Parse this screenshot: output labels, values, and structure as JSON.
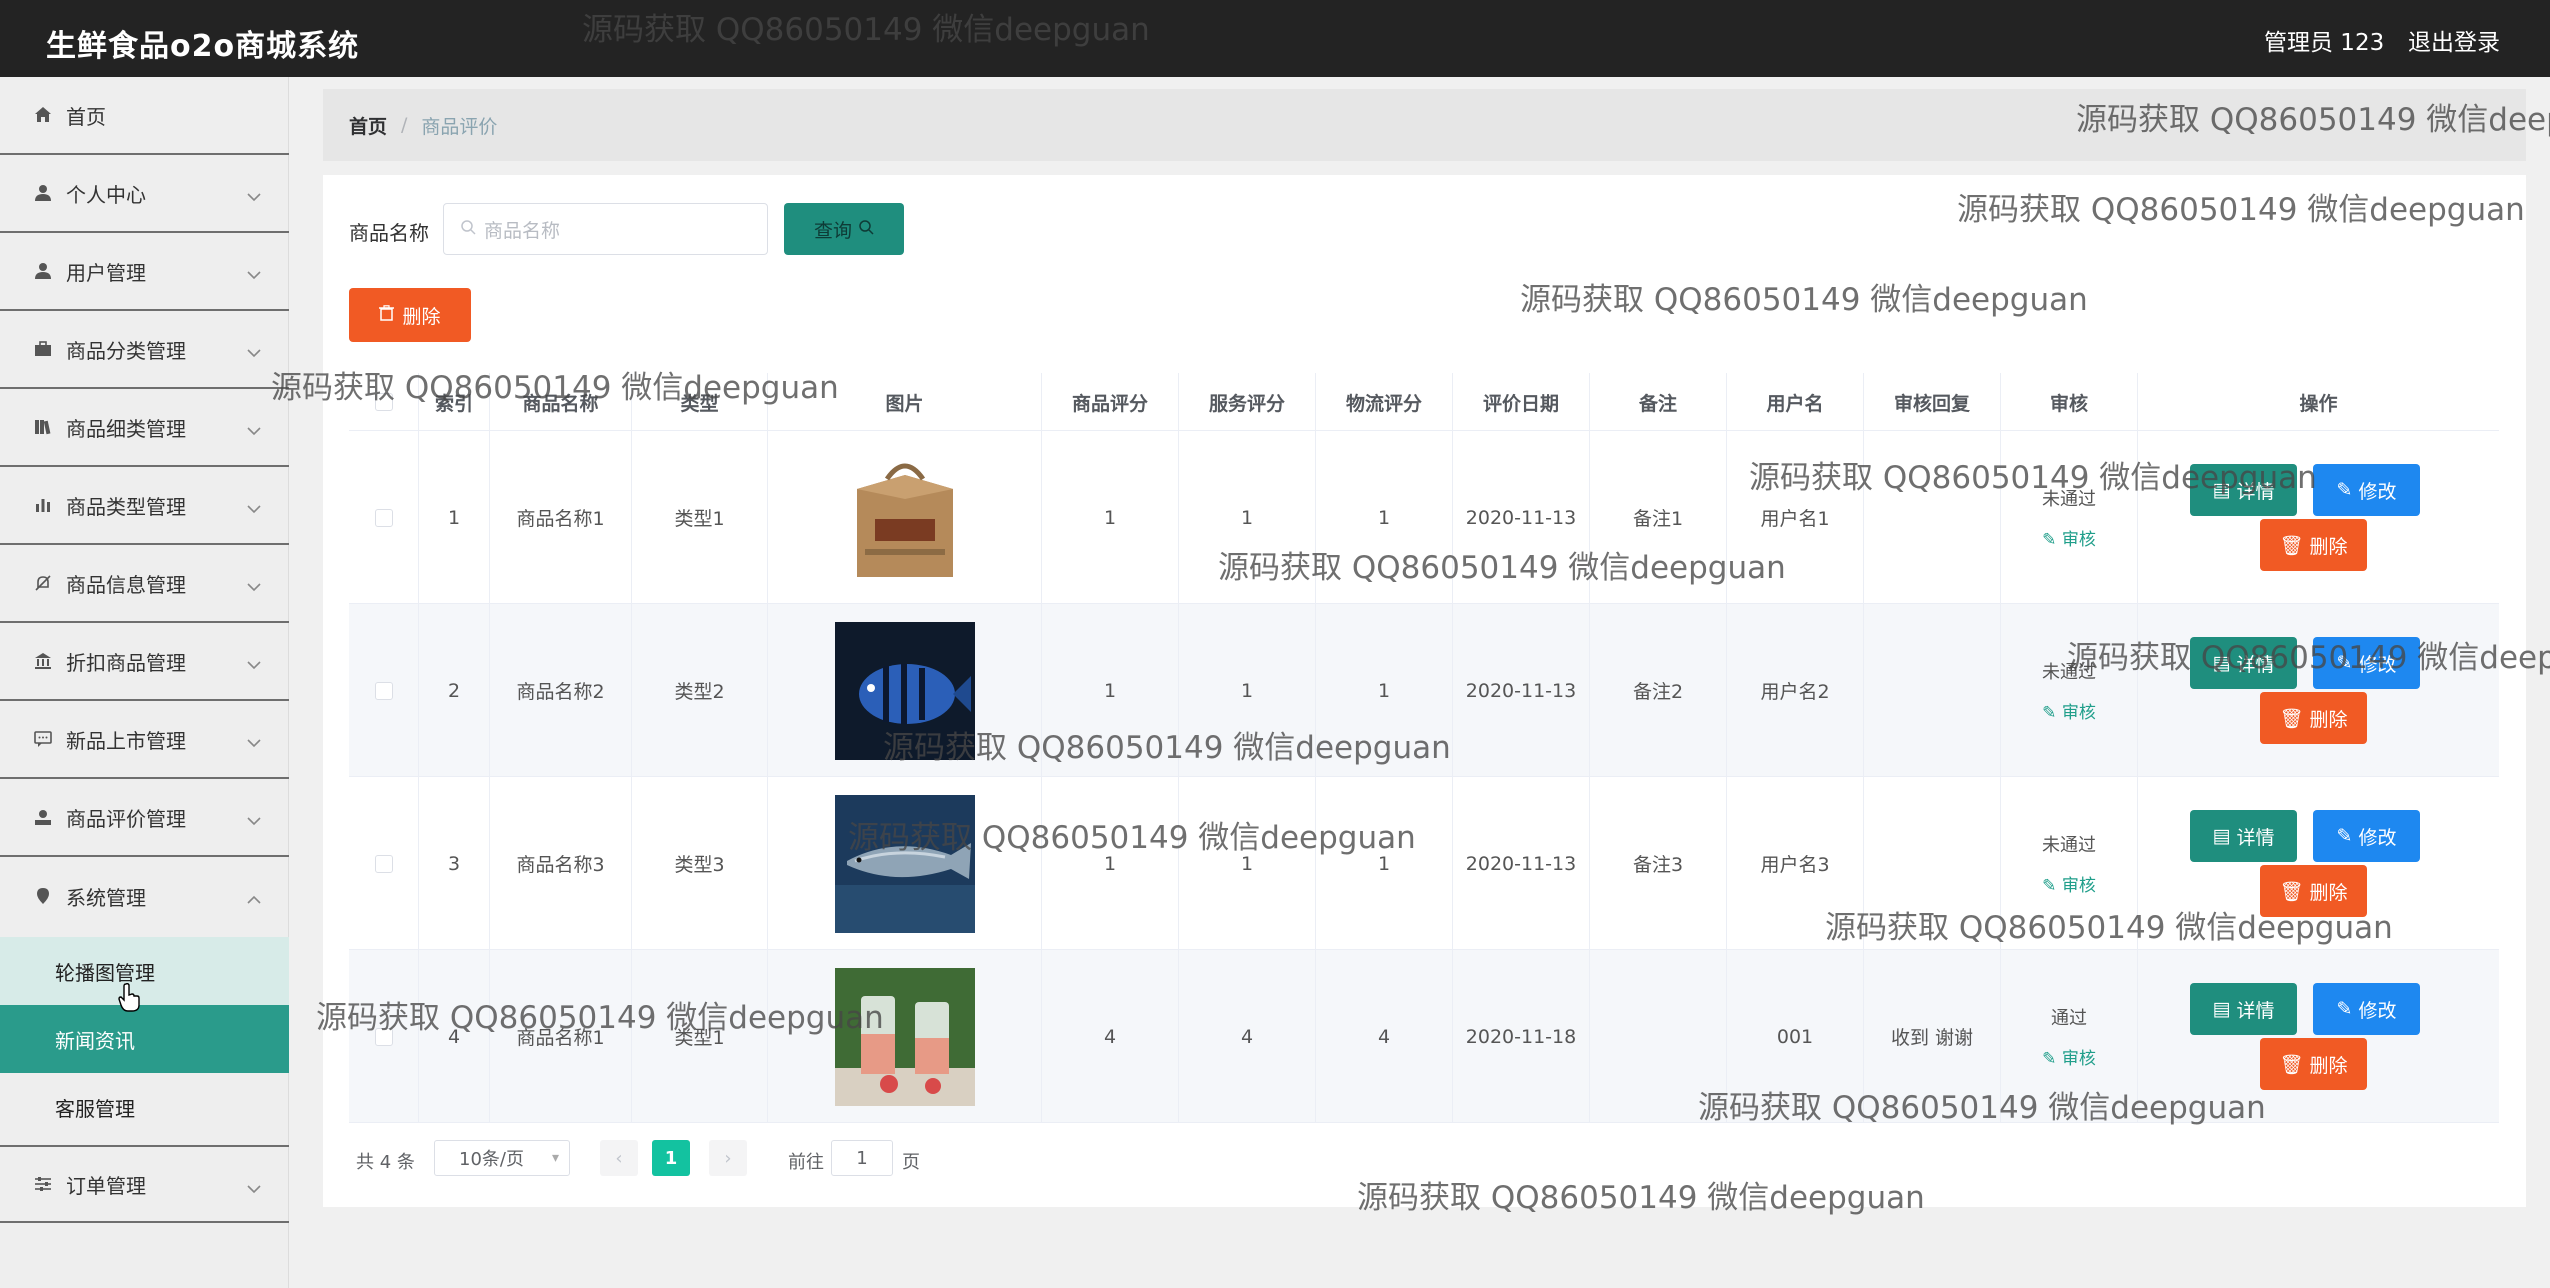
{
  "topbar": {
    "title": "生鲜食品o2o商城系统",
    "admin": "管理员 123",
    "logout": "退出登录"
  },
  "sidebar": {
    "items": [
      {
        "label": "首页",
        "icon": "home-icon"
      },
      {
        "label": "个人中心",
        "icon": "user-icon"
      },
      {
        "label": "用户管理",
        "icon": "user-icon"
      },
      {
        "label": "商品分类管理",
        "icon": "suitcase-icon"
      },
      {
        "label": "商品细类管理",
        "icon": "books-icon"
      },
      {
        "label": "商品类型管理",
        "icon": "bar-chart-icon"
      },
      {
        "label": "商品信息管理",
        "icon": "bell-off-icon"
      },
      {
        "label": "折扣商品管理",
        "icon": "bank-icon"
      },
      {
        "label": "新品上市管理",
        "icon": "chat-icon"
      },
      {
        "label": "商品评价管理",
        "icon": "user-card-icon"
      },
      {
        "label": "系统管理",
        "icon": "pin-icon"
      }
    ],
    "sub_items": [
      {
        "label": "轮播图管理"
      },
      {
        "label": "新闻资讯"
      },
      {
        "label": "客服管理"
      }
    ],
    "last_item": {
      "label": "订单管理",
      "icon": "sliders-icon"
    }
  },
  "breadcrumb": {
    "home": "首页",
    "separator": "/",
    "current": "商品评价"
  },
  "search": {
    "label": "商品名称",
    "placeholder": "商品名称",
    "button": "查询"
  },
  "batch_delete": "删除",
  "table": {
    "headers": [
      "索引",
      "商品名称",
      "类型",
      "图片",
      "商品评分",
      "服务评分",
      "物流评分",
      "评价日期",
      "备注",
      "用户名",
      "审核回复",
      "审核",
      "操作"
    ],
    "rows": [
      {
        "index": "1",
        "name": "商品名称1",
        "type": "类型1",
        "image": "gift-box",
        "goods_score": "1",
        "service_score": "1",
        "logistics_score": "1",
        "date": "2020-11-13",
        "remark": "备注1",
        "user": "用户名1",
        "reply": "",
        "status": "未通过",
        "review": "审核"
      },
      {
        "index": "2",
        "name": "商品名称2",
        "type": "类型2",
        "image": "striped-fish",
        "goods_score": "1",
        "service_score": "1",
        "logistics_score": "1",
        "date": "2020-11-13",
        "remark": "备注2",
        "user": "用户名2",
        "reply": "",
        "status": "未通过",
        "review": "审核"
      },
      {
        "index": "3",
        "name": "商品名称3",
        "type": "类型3",
        "image": "fish",
        "goods_score": "1",
        "service_score": "1",
        "logistics_score": "1",
        "date": "2020-11-13",
        "remark": "备注3",
        "user": "用户名3",
        "reply": "",
        "status": "未通过",
        "review": "审核"
      },
      {
        "index": "4",
        "name": "商品名称1",
        "type": "类型1",
        "image": "drinks",
        "goods_score": "4",
        "service_score": "4",
        "logistics_score": "4",
        "date": "2020-11-18",
        "remark": "",
        "user": "001",
        "reply": "收到 谢谢",
        "status": "通过",
        "review": "审核"
      }
    ],
    "ops": {
      "detail": "详情",
      "edit": "修改",
      "delete": "删除"
    }
  },
  "pagination": {
    "total": "共 4 条",
    "page_size": "10条/页",
    "current_page": "1",
    "goto_label": "前往",
    "goto_value": "1",
    "goto_unit": "页"
  },
  "watermark": "源码获取 QQ86050149 微信deepguan",
  "colors": {
    "topbar": "#232323",
    "accent": "#1f8e7e",
    "danger": "#f15a24",
    "primary": "#1e88f0",
    "active_menu": "#2a9b8b"
  }
}
